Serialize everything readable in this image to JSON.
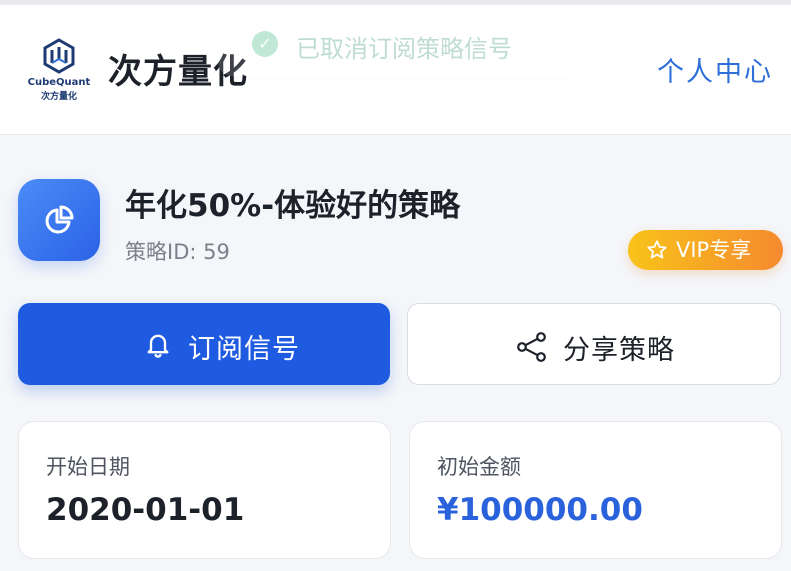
{
  "header": {
    "logo_en": "CubeQuant",
    "logo_cn": "次方量化",
    "brand": "次方量化",
    "user_center": "个人中心"
  },
  "toast": {
    "text": "已取消订阅策略信号",
    "icon": "check-circle-icon"
  },
  "strategy": {
    "icon": "pie-chart-icon",
    "title": "年化50%-体验好的策略",
    "id_text": "策略ID: 59",
    "vip_label": "VIP专享",
    "vip_icon": "star-icon"
  },
  "actions": {
    "subscribe_label": "订阅信号",
    "subscribe_icon": "bell-icon",
    "share_label": "分享策略",
    "share_icon": "share-icon"
  },
  "info": {
    "start_date_label": "开始日期",
    "start_date_value": "2020-01-01",
    "initial_amount_label": "初始金额",
    "initial_amount_value": "¥100000.00"
  },
  "colors": {
    "primary": "#1f5be0",
    "link": "#2f6fd8",
    "vip_gradient_start": "#f8c31a",
    "vip_gradient_end": "#f58a2e",
    "amount": "#2a62dc"
  }
}
